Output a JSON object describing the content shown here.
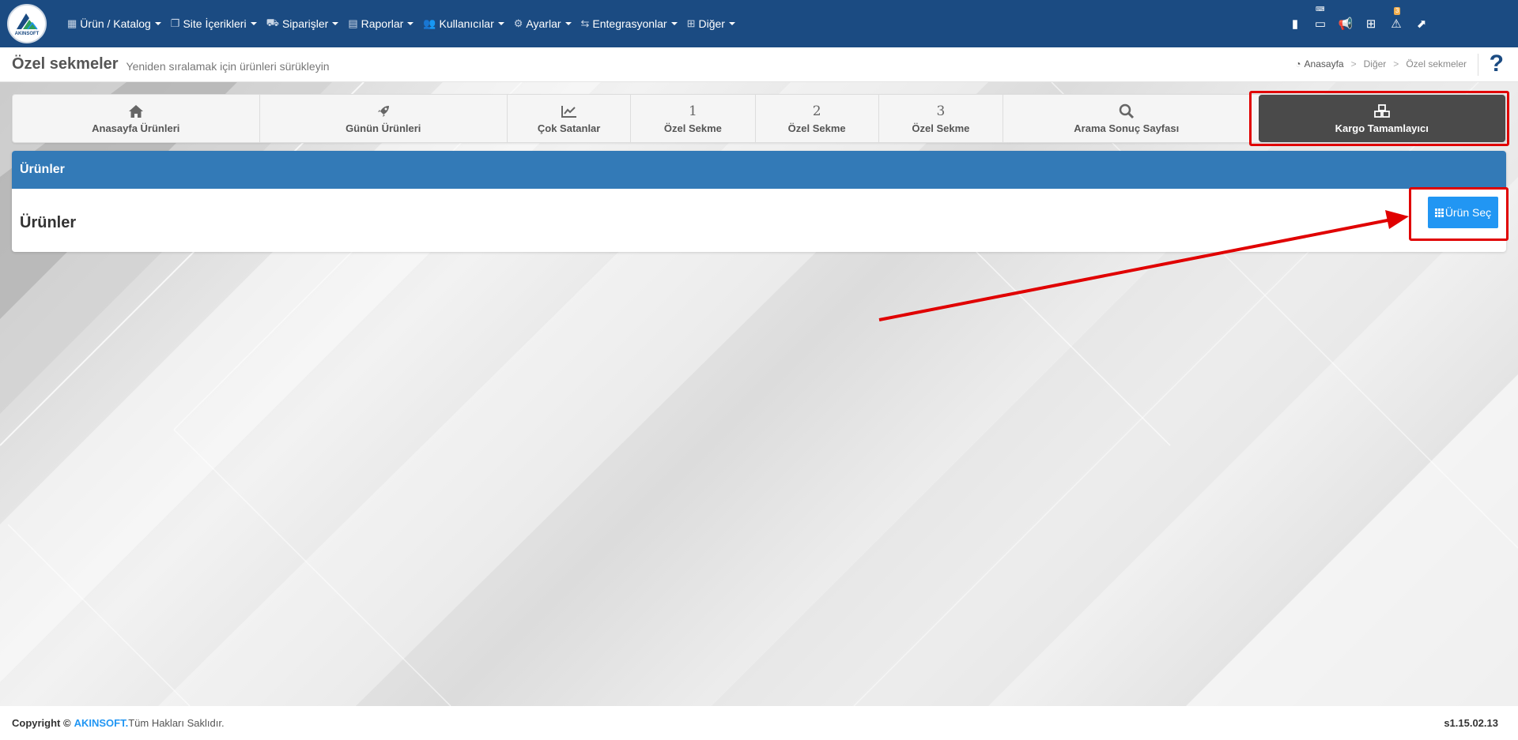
{
  "logo": {
    "text": "AKINSOFT"
  },
  "nav": {
    "items": [
      {
        "label": "Ürün / Katalog",
        "icon": "catalog-icon"
      },
      {
        "label": "Site İçerikleri",
        "icon": "content-icon"
      },
      {
        "label": "Siparişler",
        "icon": "orders-icon"
      },
      {
        "label": "Raporlar",
        "icon": "reports-icon"
      },
      {
        "label": "Kullanıcılar",
        "icon": "users-icon"
      },
      {
        "label": "Ayarlar",
        "icon": "settings-icon"
      },
      {
        "label": "Entegrasyonlar",
        "icon": "integrations-icon"
      },
      {
        "label": "Diğer",
        "icon": "other-icon"
      }
    ],
    "right_icons": [
      "book-icon",
      "keyboard-icon",
      "megaphone-icon",
      "grid-icon",
      "warning-icon",
      "external-link-icon"
    ],
    "warning_badge": "3"
  },
  "header": {
    "title": "Özel sekmeler",
    "subtitle": "Yeniden sıralamak için ürünleri sürükleyin",
    "breadcrumb": [
      "Anasayfa",
      "Diğer",
      "Özel sekmeler"
    ],
    "help": "?"
  },
  "tabs": [
    {
      "label": "Anasayfa Ürünleri",
      "icon": "home-icon"
    },
    {
      "label": "Günün Ürünleri",
      "icon": "rocket-icon"
    },
    {
      "label": "Çok Satanlar",
      "icon": "line-chart-icon"
    },
    {
      "label": "Özel Sekme",
      "number": "1"
    },
    {
      "label": "Özel Sekme",
      "number": "2"
    },
    {
      "label": "Özel Sekme",
      "number": "3"
    },
    {
      "label": "Arama Sonuç Sayfası",
      "icon": "search-icon"
    },
    {
      "label": "Kargo Tamamlayıcı",
      "icon": "cubes-icon",
      "active": true
    }
  ],
  "panel": {
    "heading": "Ürünler",
    "body_title": "Ürünler",
    "select_button": "Ürün Seç"
  },
  "footer": {
    "copyright": "Copyright ©",
    "brand": "AKINSOFT.",
    "rights": "Tüm Hakları Saklıdır.",
    "version": "s1.15.02.13"
  },
  "colors": {
    "nav_bg": "#1b4b82",
    "panel_head": "#337ab7",
    "button": "#2196f3",
    "active_tab": "#4a4a4a",
    "highlight": "#e00000"
  }
}
